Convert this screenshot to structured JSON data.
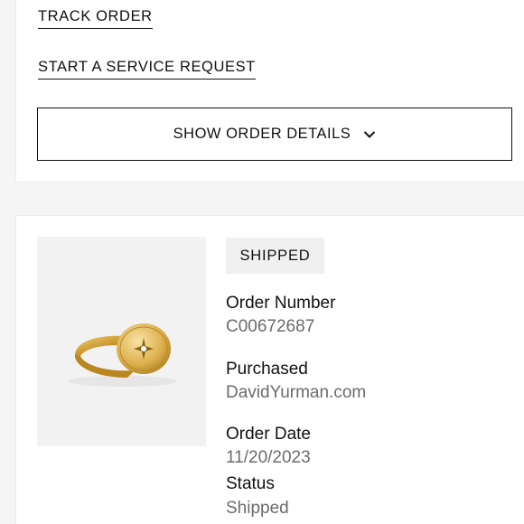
{
  "actions": {
    "track_order": "TRACK ORDER",
    "service_request": "START A SERVICE REQUEST",
    "show_details": "SHOW ORDER DETAILS"
  },
  "order": {
    "status_badge": "SHIPPED",
    "product_image": "gold-signet-ring-with-star-diamond",
    "fields": {
      "order_number_label": "Order Number",
      "order_number": "C00672687",
      "purchased_label": "Purchased",
      "purchased": "DavidYurman.com",
      "order_date_label": "Order Date",
      "order_date": "11/20/2023",
      "status_label": "Status",
      "status": "Shipped"
    }
  },
  "colors": {
    "text": "#111111",
    "muted": "#6b6b6b",
    "badge_bg": "#f0f0f0",
    "ring_gold": "#d4a53a"
  }
}
